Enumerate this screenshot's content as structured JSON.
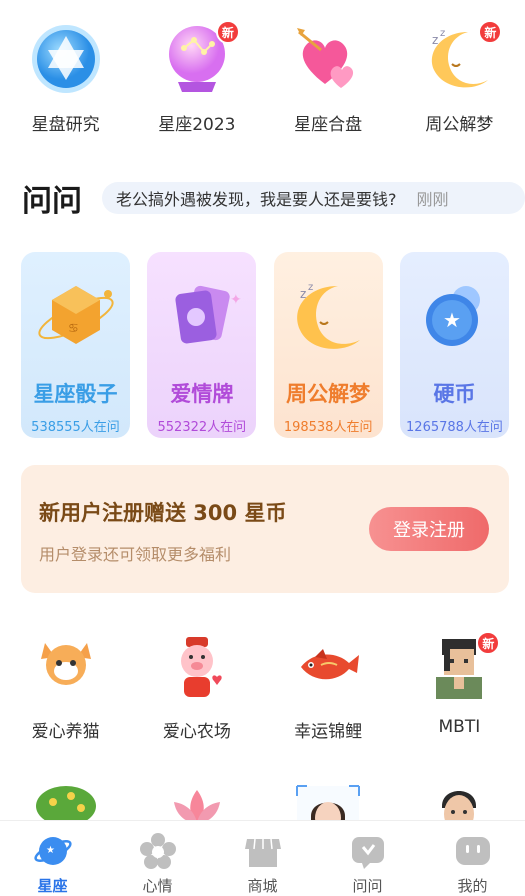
{
  "top_items": [
    {
      "label": "星盘研究",
      "icon": "star-of-david-icon",
      "badge": ""
    },
    {
      "label": "星座2023",
      "icon": "crystal-ball-icon",
      "badge": "新"
    },
    {
      "label": "星座合盘",
      "icon": "hearts-icon",
      "badge": ""
    },
    {
      "label": "周公解梦",
      "icon": "sleeping-moon-icon",
      "badge": "新"
    }
  ],
  "ask": {
    "title": "问问",
    "question": "老公搞外遇被发现，我是要人还是要钱?",
    "time": "刚刚"
  },
  "cards": [
    {
      "title": "星座骰子",
      "sub": "538555人在问",
      "color": "#3a9ee6"
    },
    {
      "title": "爱情牌",
      "sub": "552322人在问",
      "color": "#b14bd9"
    },
    {
      "title": "周公解梦",
      "sub": "198538人在问",
      "color": "#ef7d2d"
    },
    {
      "title": "硬币",
      "sub": "1265788人在问",
      "color": "#5a76e6"
    }
  ],
  "promo": {
    "title": "新用户注册赠送 300 星币",
    "sub": "用户登录还可领取更多福利",
    "button": "登录注册"
  },
  "grid_items": [
    {
      "label": "爱心养猫",
      "icon": "cat-icon",
      "badge": ""
    },
    {
      "label": "爱心农场",
      "icon": "pig-icon",
      "badge": ""
    },
    {
      "label": "幸运锦鲤",
      "icon": "koi-fish-icon",
      "badge": ""
    },
    {
      "label": "MBTI",
      "icon": "person-icon",
      "badge": "新"
    }
  ],
  "grid_row3_icons": [
    "tree-icon",
    "lotus-icon",
    "woman-portrait-icon",
    "man-portrait-icon"
  ],
  "nav": [
    {
      "label": "星座",
      "icon": "planet-icon",
      "active": true
    },
    {
      "label": "心情",
      "icon": "mood-flower-icon",
      "active": false
    },
    {
      "label": "商城",
      "icon": "shop-icon",
      "active": false
    },
    {
      "label": "问问",
      "icon": "chat-bubble-icon",
      "active": false
    },
    {
      "label": "我的",
      "icon": "profile-icon",
      "active": false
    }
  ],
  "colors": {
    "accent": "#2a74e8",
    "badge": "#f23c3c",
    "promo_bg": "#fdeee2",
    "promo_title": "#7a4a17"
  }
}
